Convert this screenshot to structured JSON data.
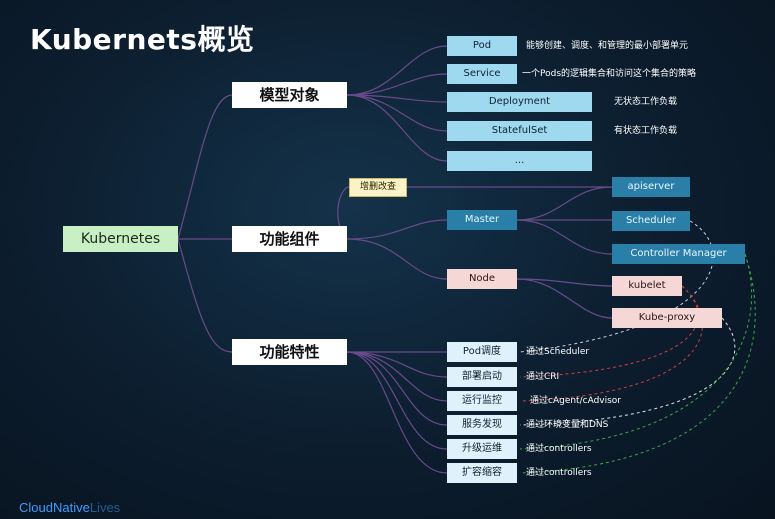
{
  "title": "Kubernets概览",
  "root": "Kubernetes",
  "categories": {
    "model": "模型对象",
    "components": "功能组件",
    "features": "功能特性"
  },
  "model_objects": [
    {
      "label": "Pod",
      "desc": "能够创建、调度、和管理的最小部署单元"
    },
    {
      "label": "Service",
      "desc": "一个Pods的逻辑集合和访问这个集合的策略"
    },
    {
      "label": "Deployment",
      "desc": "无状态工作负载"
    },
    {
      "label": "StatefulSet",
      "desc": "有状态工作负载"
    },
    {
      "label": "...",
      "desc": ""
    }
  ],
  "crud_label": "增删改查",
  "components": {
    "master": "Master",
    "node": "Node",
    "apiserver": "apiserver",
    "scheduler": "Scheduler",
    "controller_manager": "Controller Manager",
    "kubelet": "kubelet",
    "kube_proxy": "Kube-proxy"
  },
  "features": [
    {
      "label": "Pod调度",
      "desc": "通过Scheduler"
    },
    {
      "label": "部署启动",
      "desc": "通过CRI"
    },
    {
      "label": "运行监控",
      "desc": "通过cAgent/cAdvisor"
    },
    {
      "label": "服务发现",
      "desc": "通过环境变量和DNS"
    },
    {
      "label": "升级运维",
      "desc": "通过controllers"
    },
    {
      "label": "扩容缩容",
      "desc": "通过controllers"
    }
  ],
  "footer": {
    "part1": "CloudNative",
    "part2": "Lives"
  },
  "colors": {
    "wire": "#6a4a8a",
    "feature_box": "#4a2230",
    "feature_border": "#c03040"
  }
}
